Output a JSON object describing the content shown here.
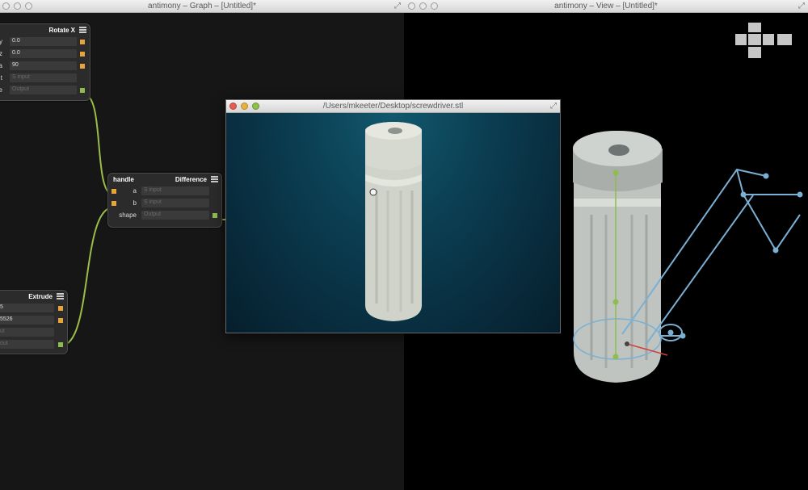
{
  "graph_window": {
    "title": "antimony – Graph – [Untitled]*"
  },
  "view_window": {
    "title": "antimony – View – [Untitled]*"
  },
  "stl_viewer": {
    "title": "/Users/mkeeter/Desktop/screwdriver.stl"
  },
  "nodes": {
    "rotate": {
      "type": "Rotate X",
      "rows": [
        {
          "label": "y",
          "value": "0.0",
          "placeholder": false
        },
        {
          "label": "z",
          "value": "0.0",
          "placeholder": false
        },
        {
          "label": "a",
          "value": "90",
          "placeholder": false
        },
        {
          "label": "t",
          "value": "S input",
          "placeholder": true
        },
        {
          "label": "e",
          "value": "Output",
          "placeholder": true
        }
      ]
    },
    "difference": {
      "name": "handle",
      "type": "Difference",
      "rows": [
        {
          "label": "a",
          "value": "S input"
        },
        {
          "label": "b",
          "value": "S input"
        },
        {
          "label": "shape",
          "value": "Output"
        }
      ]
    },
    "extrude": {
      "type": "Extrude",
      "rows": [
        {
          "label": "",
          "value": "5",
          "placeholder": false
        },
        {
          "label": "",
          "value": "5526",
          "placeholder": false
        },
        {
          "label": "",
          "value": "ut",
          "placeholder": true
        },
        {
          "label": "",
          "value": "out",
          "placeholder": true
        }
      ]
    }
  },
  "colors": {
    "graph_bg": "#161616",
    "node_bg": "#2b2b2b",
    "port_input": "#e8a33a",
    "port_output": "#8fbc4f",
    "wire": "#9bbd4a",
    "viewer_bg": "#0b3e52",
    "model": "#d6d9cc",
    "handle_lines": "#7ab0d4"
  }
}
